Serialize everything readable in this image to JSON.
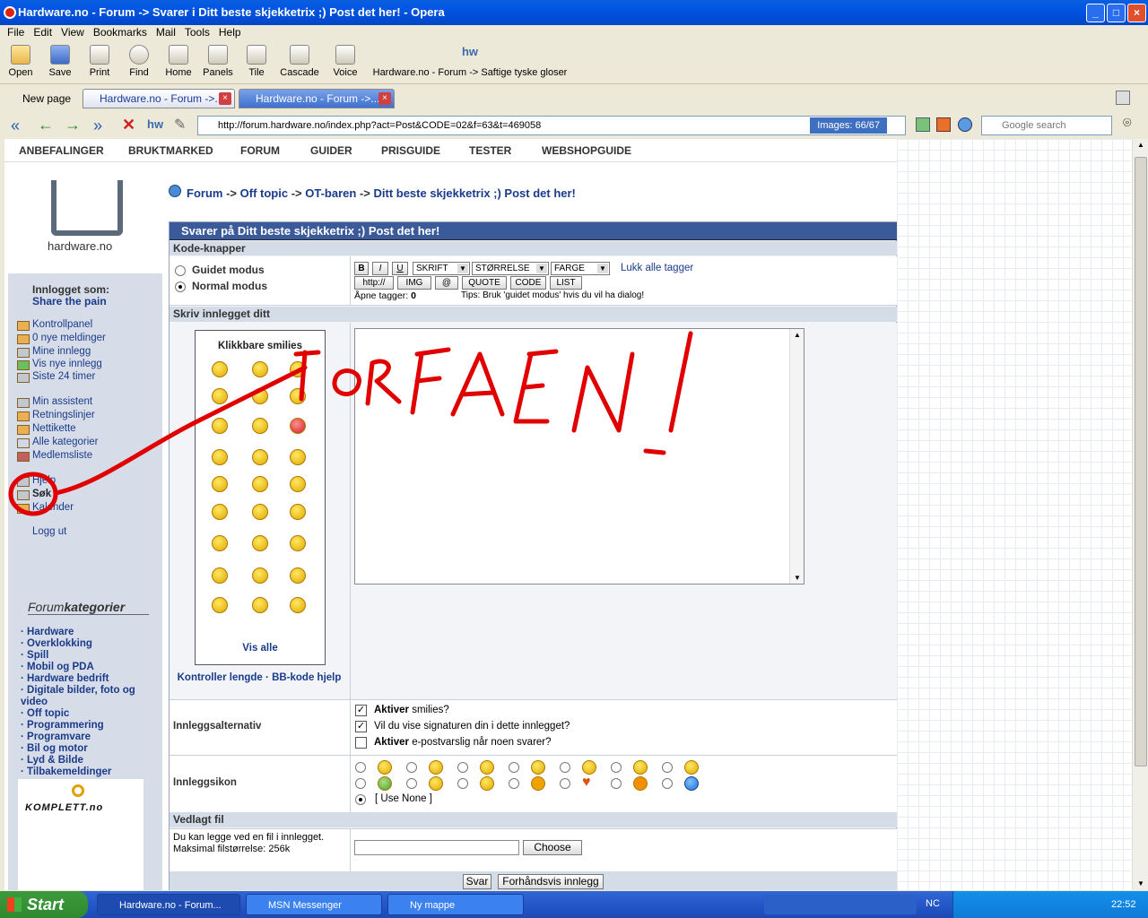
{
  "window": {
    "title": "Hardware.no - Forum -> Svarer i Ditt beste skjekketrix ;) Post det her! - Opera"
  },
  "menu": [
    "File",
    "Edit",
    "View",
    "Bookmarks",
    "Mail",
    "Tools",
    "Help"
  ],
  "toolbar": {
    "open": "Open",
    "save": "Save",
    "print": "Print",
    "find": "Find",
    "home": "Home",
    "panels": "Panels",
    "tile": "Tile",
    "cascade": "Cascade",
    "voice": "Voice",
    "bookmark_title": "Hardware.no - Forum -> Saftige tyske gloser"
  },
  "tabs": {
    "new_page": "New page",
    "tab1": "Hardware.no - Forum ->...",
    "tab2": "Hardware.no - Forum ->..."
  },
  "address": {
    "url": "http://forum.hardware.no/index.php?act=Post&CODE=02&f=63&t=469058",
    "images": "Images: 66/67",
    "search_placeholder": "Google search"
  },
  "site": {
    "nav": [
      "ANBEFALINGER",
      "BRUKTMARKED",
      "FORUM",
      "GUIDER",
      "PRISGUIDE",
      "TESTER",
      "WEBSHOPGUIDE"
    ],
    "logo_text": "hardware.no",
    "logged_in_label": "Innlogget som:",
    "username": "Share the pain",
    "side_links1": [
      "Kontrollpanel",
      "0 nye meldinger",
      "Mine innlegg",
      "Vis nye innlegg",
      "Siste 24 timer"
    ],
    "side_links2": [
      "Min assistent",
      "Retningslinjer",
      "Nettikette",
      "Alle kategorier",
      "Medlemsliste"
    ],
    "side_links3": [
      "Hjelp",
      "Søk",
      "Kalender"
    ],
    "logout": "Logg ut",
    "forumkat_a": "Forum",
    "forumkat_b": "kategorier",
    "categories": [
      "Hardware",
      "Overklokking",
      "Spill",
      "Mobil og PDA",
      "Hardware bedrift",
      "Digitale bilder, foto og video",
      "Off topic",
      "Programmering",
      "Programvare",
      "Bil og motor",
      "Lyd & Bilde",
      "Tilbakemeldinger"
    ],
    "komplett": "KOMPLETT.no",
    "breadcrumb": [
      "Forum",
      "Off topic",
      "OT-baren",
      "Ditt beste skjekketrix ;) Post det her!"
    ],
    "breadcrumb_sep": "->"
  },
  "form": {
    "title": "Svarer på Ditt beste skjekketrix ;) Post det her!",
    "kode_knapper": "Kode-knapper",
    "guided": "Guidet modus",
    "normal": "Normal modus",
    "btns": {
      "b": "B",
      "i": "I",
      "u": "U",
      "skrift": "SKRIFT",
      "storrelse": "STØRRELSE",
      "farge": "FARGE",
      "close_all": "Lukk alle tagger",
      "http": "http://",
      "img": "IMG",
      "at": "@",
      "quote": "QUOTE",
      "code": "CODE",
      "list": "LIST"
    },
    "open_tags_label": "Åpne tagger:",
    "open_tags_count": "0",
    "tips": "Tips: Bruk 'guidet modus' hvis du vil ha dialog!",
    "write_post": "Skriv innlegget ditt",
    "smilies_title": "Klikkbare smilies",
    "show_all": "Vis alle",
    "control_length": "Kontroller lengde",
    "dot": "·",
    "bbcode_help": "BB-kode hjelp",
    "post_options": "Innleggsalternativ",
    "opt1_b": "Aktiver",
    "opt1_r": " smilies?",
    "opt2": "Vil du vise signaturen din i dette innlegget?",
    "opt3_b": "Aktiver",
    "opt3_r": " e-postvarslig når noen svarer?",
    "post_icon": "Innleggsikon",
    "use_none": "[ Use None ]",
    "attached": "Vedlagt fil",
    "attach_desc": "Du kan legge ved en fil i innlegget.",
    "max_size": "Maksimal filstørrelse: 256k",
    "choose": "Choose",
    "submit": "Svar",
    "preview": "Forhåndsvis innlegg"
  },
  "drawing": {
    "text": "FORFAEN!",
    "color": "#e00000"
  },
  "taskbar": {
    "start": "Start",
    "items": [
      "Hardware.no - Forum...",
      "MSN Messenger",
      "Ny mappe"
    ],
    "lang": "NC",
    "clock": "22:52"
  }
}
